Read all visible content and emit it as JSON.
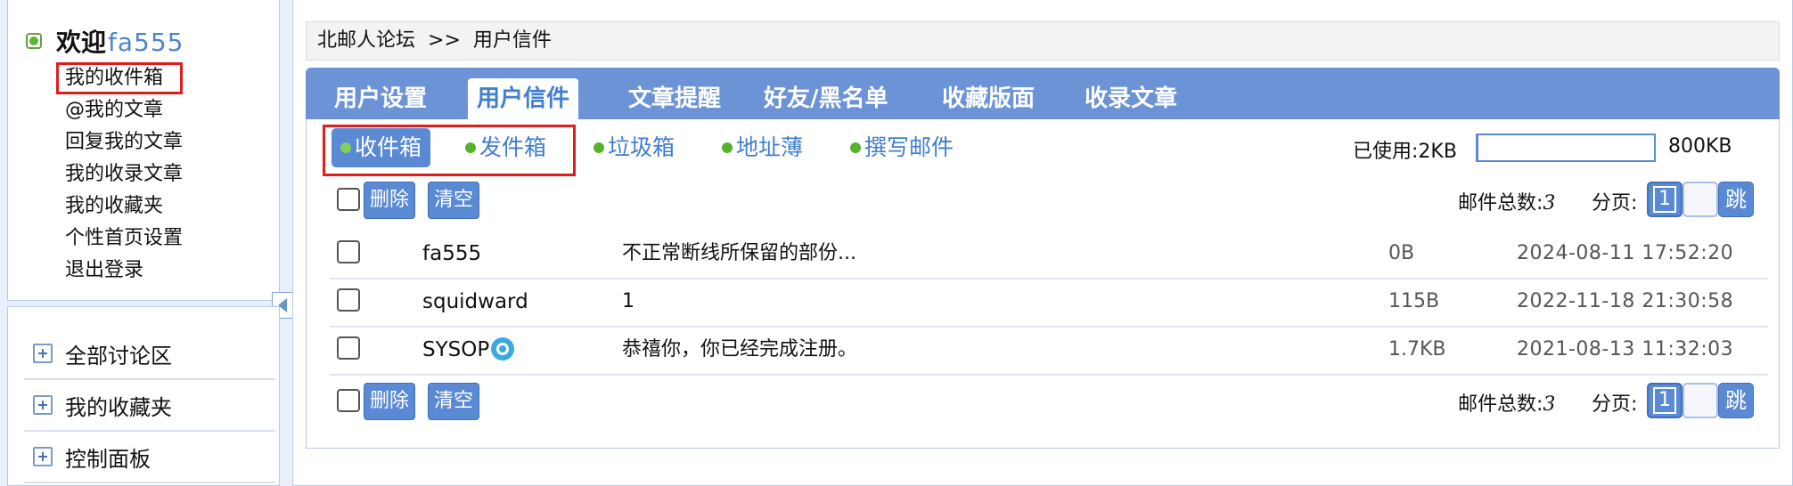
{
  "sidebar": {
    "welcome_prefix": "欢迎",
    "username": "fa555",
    "links": [
      {
        "label": "我的收件箱"
      },
      {
        "label": "@我的文章"
      },
      {
        "label": "回复我的文章"
      },
      {
        "label": "我的收录文章"
      },
      {
        "label": "我的收藏夹"
      },
      {
        "label": "个性首页设置"
      },
      {
        "label": "退出登录"
      }
    ],
    "sections": [
      {
        "label": "全部讨论区"
      },
      {
        "label": "我的收藏夹"
      },
      {
        "label": "控制面板"
      }
    ]
  },
  "breadcrumb": {
    "site": "北邮人论坛",
    "separator": ">>",
    "current": "用户信件"
  },
  "tabs": [
    {
      "label": "用户设置",
      "active": false
    },
    {
      "label": "用户信件",
      "active": true
    },
    {
      "label": "文章提醒",
      "active": false
    },
    {
      "label": "好友/黑名单",
      "active": false
    },
    {
      "label": "收藏版面",
      "active": false
    },
    {
      "label": "收录文章",
      "active": false
    }
  ],
  "mail_tabs": [
    {
      "label": "收件箱",
      "active": true
    },
    {
      "label": "发件箱",
      "active": false
    },
    {
      "label": "垃圾箱",
      "active": false
    },
    {
      "label": "地址薄",
      "active": false
    },
    {
      "label": "撰写邮件",
      "active": false
    }
  ],
  "quota": {
    "used_label": "已使用:2KB",
    "used_fraction": 0.0025,
    "total_label": "800KB"
  },
  "toolbar": {
    "delete_label": "删除",
    "clear_label": "清空",
    "total_label": "邮件总数:",
    "total_count": "3",
    "page_label": "分页:",
    "current_page": "1",
    "jump_label": "跳"
  },
  "mails": [
    {
      "sender": "fa555",
      "subject": "不正常断线所保留的部份...",
      "size": "0B",
      "date": "2024-08-11 17:52:20",
      "verified": false
    },
    {
      "sender": "squidward",
      "subject": "1",
      "size": "115B",
      "date": "2022-11-18 21:30:58",
      "verified": false
    },
    {
      "sender": "SYSOP",
      "subject": "恭禧你，你已经完成注册。",
      "size": "1.7KB",
      "date": "2021-08-13 11:32:03",
      "verified": true
    }
  ],
  "colors": {
    "accent": "#5b8ad4",
    "tabbar": "#6b93d6",
    "link": "#3f7ed3",
    "highlight_outline": "#e01c1c",
    "status_green": "#5bb534"
  }
}
